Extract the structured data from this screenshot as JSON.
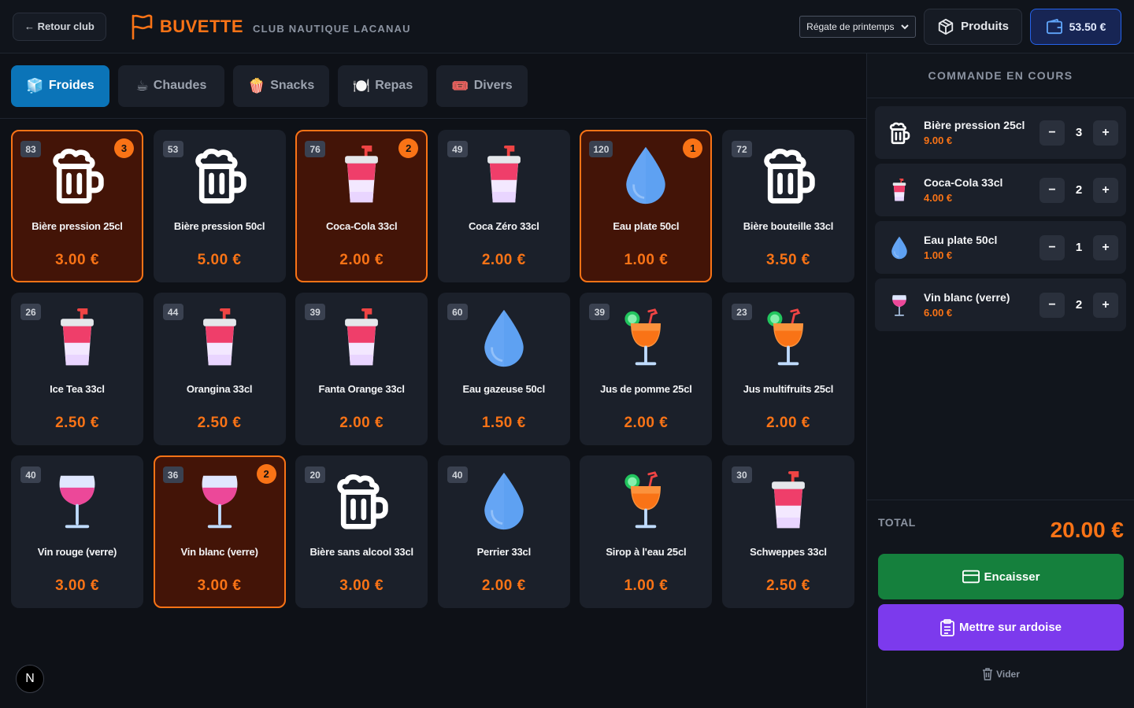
{
  "header": {
    "back_label": "← Retour club",
    "brand_title": "BUVETTE",
    "brand_subtitle": "CLUB NAUTIQUE LACANAU",
    "event_select": "Régate de printemps",
    "products_label": "Produits",
    "wallet_label": "53.50 €"
  },
  "tabs": [
    {
      "label": "Froides",
      "emoji": "🧊",
      "active": true
    },
    {
      "label": "Chaudes",
      "emoji": "☕",
      "active": false
    },
    {
      "label": "Snacks",
      "emoji": "🍿",
      "active": false
    },
    {
      "label": "Repas",
      "emoji": "🍽️",
      "active": false
    },
    {
      "label": "Divers",
      "emoji": "🎟️",
      "active": false
    }
  ],
  "products": [
    {
      "name": "Bière pression 25cl",
      "price": "3.00 €",
      "stock": "83",
      "qty": "3",
      "icon": "beer-mug-icon"
    },
    {
      "name": "Bière pression 50cl",
      "price": "5.00 €",
      "stock": "53",
      "qty": "",
      "icon": "beer-mug-icon"
    },
    {
      "name": "Coca-Cola 33cl",
      "price": "2.00 €",
      "stock": "76",
      "qty": "2",
      "icon": "soda-cup-icon"
    },
    {
      "name": "Coca Zéro 33cl",
      "price": "2.00 €",
      "stock": "49",
      "qty": "",
      "icon": "soda-cup-icon"
    },
    {
      "name": "Eau plate 50cl",
      "price": "1.00 €",
      "stock": "120",
      "qty": "1",
      "icon": "water-drop-icon"
    },
    {
      "name": "Bière bouteille 33cl",
      "price": "3.50 €",
      "stock": "72",
      "qty": "",
      "icon": "beer-mug-icon"
    },
    {
      "name": "Ice Tea 33cl",
      "price": "2.50 €",
      "stock": "26",
      "qty": "",
      "icon": "soda-cup-icon"
    },
    {
      "name": "Orangina 33cl",
      "price": "2.50 €",
      "stock": "44",
      "qty": "",
      "icon": "soda-cup-icon"
    },
    {
      "name": "Fanta Orange 33cl",
      "price": "2.00 €",
      "stock": "39",
      "qty": "",
      "icon": "soda-cup-icon"
    },
    {
      "name": "Eau gazeuse 50cl",
      "price": "1.50 €",
      "stock": "60",
      "qty": "",
      "icon": "water-drop-icon"
    },
    {
      "name": "Jus de pomme 25cl",
      "price": "2.00 €",
      "stock": "39",
      "qty": "",
      "icon": "tropical-drink-icon"
    },
    {
      "name": "Jus multifruits 25cl",
      "price": "2.00 €",
      "stock": "23",
      "qty": "",
      "icon": "tropical-drink-icon"
    },
    {
      "name": "Vin rouge (verre)",
      "price": "3.00 €",
      "stock": "40",
      "qty": "",
      "icon": "wine-glass-icon"
    },
    {
      "name": "Vin blanc (verre)",
      "price": "3.00 €",
      "stock": "36",
      "qty": "2",
      "icon": "wine-glass-icon"
    },
    {
      "name": "Bière sans alcool 33cl",
      "price": "3.00 €",
      "stock": "20",
      "qty": "",
      "icon": "beer-mug-icon"
    },
    {
      "name": "Perrier 33cl",
      "price": "2.00 €",
      "stock": "40",
      "qty": "",
      "icon": "water-drop-icon"
    },
    {
      "name": "Sirop à l'eau 25cl",
      "price": "1.00 €",
      "stock": "",
      "qty": "",
      "icon": "tropical-drink-icon"
    },
    {
      "name": "Schweppes 33cl",
      "price": "2.50 €",
      "stock": "30",
      "qty": "",
      "icon": "soda-cup-icon"
    }
  ],
  "order": {
    "title": "COMMANDE EN COURS",
    "items": [
      {
        "name": "Bière pression 25cl",
        "price": "9.00 €",
        "qty": "3",
        "icon": "beer-mug-icon"
      },
      {
        "name": "Coca-Cola 33cl",
        "price": "4.00 €",
        "qty": "2",
        "icon": "soda-cup-icon"
      },
      {
        "name": "Eau plate 50cl",
        "price": "1.00 €",
        "qty": "1",
        "icon": "water-drop-icon"
      },
      {
        "name": "Vin blanc (verre)",
        "price": "6.00 €",
        "qty": "2",
        "icon": "wine-glass-icon"
      }
    ],
    "total_label": "TOTAL",
    "total_value": "20.00 €",
    "pay_label": "Encaisser",
    "tab_label": "Mettre sur ardoise",
    "clear_label": "Vider"
  },
  "dev_badge": "N",
  "colors": {
    "accent": "#f97316",
    "active_tab": "#0b74b8",
    "pay_button": "#15803d",
    "tab_button": "#7c3aed",
    "wallet_border": "#2563eb"
  }
}
